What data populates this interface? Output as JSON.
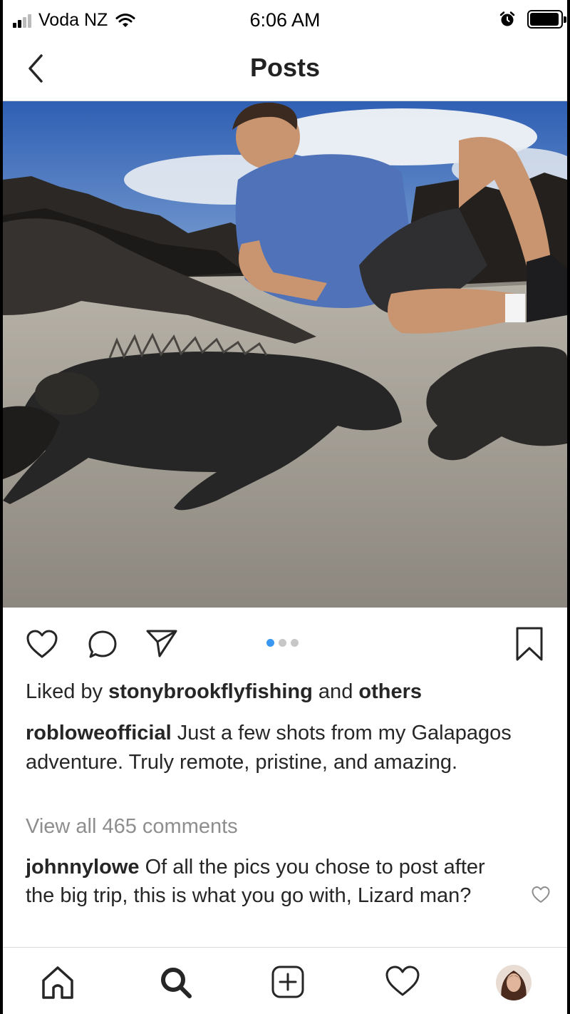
{
  "status_bar": {
    "carrier": "Voda NZ",
    "time": "6:06 AM",
    "signal_bars_filled": 2,
    "signal_bars_total": 4,
    "battery_level": 0.95,
    "icons": [
      "signal-icon",
      "wifi-icon",
      "alarm-icon",
      "battery-icon"
    ]
  },
  "nav": {
    "title": "Posts",
    "back_icon": "chevron-left-icon"
  },
  "post": {
    "photo_alt_icon": "photo",
    "carousel": {
      "total": 3,
      "active_index": 0
    },
    "likes": {
      "prefix": "Liked by ",
      "liker": "stonybrookflyfishing",
      "middle": " and ",
      "others": "others"
    },
    "caption": {
      "username": "robloweofficial",
      "text": "Just a few shots from my Galapagos adventure. Truly remote, pristine, and amazing."
    },
    "view_comments": "View all 465 comments",
    "top_comment": {
      "username": "johnnylowe",
      "text": "Of all the pics you chose to post after the big trip, this is what you go with, Lizard man?"
    }
  },
  "actions": [
    "heart-icon",
    "comment-icon",
    "share-icon",
    "bookmark-icon"
  ],
  "tab_bar": [
    "home-icon",
    "search-icon",
    "add-post-icon",
    "activity-heart-icon",
    "profile-avatar"
  ],
  "colors": {
    "accent": "#3897f0",
    "text": "#262626",
    "muted": "#8e8e8e",
    "divider": "#dbdbdb"
  }
}
